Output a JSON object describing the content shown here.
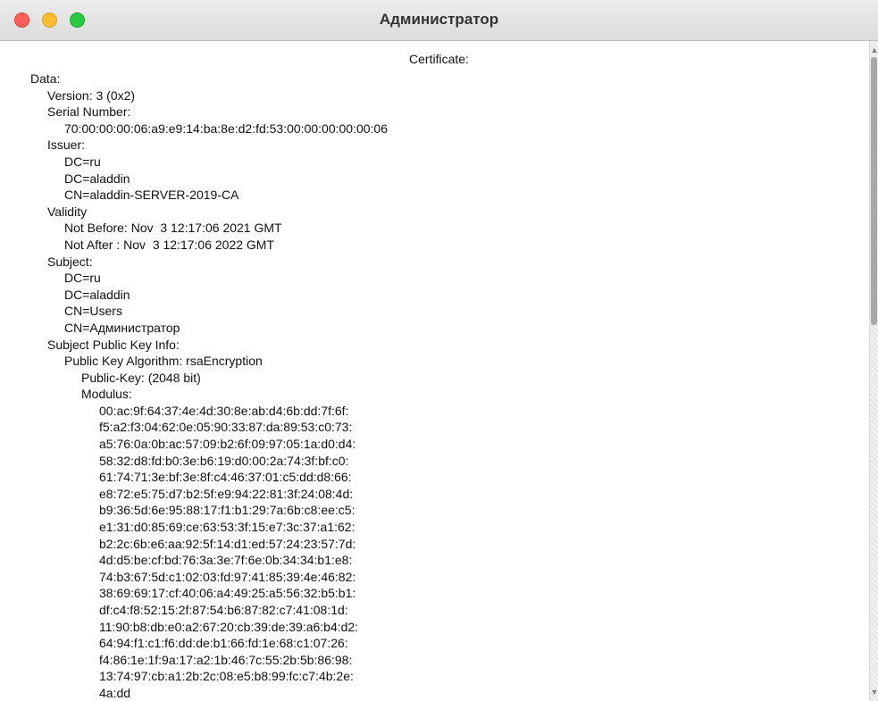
{
  "window": {
    "title": "Администратор",
    "controls": [
      "close-icon",
      "minimize-icon",
      "maximize-icon"
    ],
    "colors": {
      "close": "#ff5f57",
      "minimize": "#febc2e",
      "maximize": "#28c840"
    }
  },
  "certificate": {
    "header": "Certificate:",
    "lines": [
      {
        "indent": 0,
        "text": "Data:"
      },
      {
        "indent": 1,
        "text": "Version: 3 (0x2)"
      },
      {
        "indent": 1,
        "text": "Serial Number:"
      },
      {
        "indent": 2,
        "text": "70:00:00:00:06:a9:e9:14:ba:8e:d2:fd:53:00:00:00:00:00:06"
      },
      {
        "indent": 1,
        "text": "Issuer:"
      },
      {
        "indent": 2,
        "text": "DC=ru"
      },
      {
        "indent": 2,
        "text": "DC=aladdin"
      },
      {
        "indent": 2,
        "text": "CN=aladdin-SERVER-2019-CA"
      },
      {
        "indent": 1,
        "text": "Validity"
      },
      {
        "indent": 2,
        "text": "Not Before: Nov  3 12:17:06 2021 GMT"
      },
      {
        "indent": 2,
        "text": "Not After : Nov  3 12:17:06 2022 GMT"
      },
      {
        "indent": 1,
        "text": "Subject:"
      },
      {
        "indent": 2,
        "text": "DC=ru"
      },
      {
        "indent": 2,
        "text": "DC=aladdin"
      },
      {
        "indent": 2,
        "text": "CN=Users"
      },
      {
        "indent": 2,
        "text": "CN=Администратор"
      },
      {
        "indent": 1,
        "text": "Subject Public Key Info:"
      },
      {
        "indent": 2,
        "text": "Public Key Algorithm: rsaEncryption"
      },
      {
        "indent": 3,
        "text": "Public-Key: (2048 bit)"
      },
      {
        "indent": 3,
        "text": "Modulus:"
      },
      {
        "indent": 4,
        "text": "00:ac:9f:64:37:4e:4d:30:8e:ab:d4:6b:dd:7f:6f:"
      },
      {
        "indent": 4,
        "text": "f5:a2:f3:04:62:0e:05:90:33:87:da:89:53:c0:73:"
      },
      {
        "indent": 4,
        "text": "a5:76:0a:0b:ac:57:09:b2:6f:09:97:05:1a:d0:d4:"
      },
      {
        "indent": 4,
        "text": "58:32:d8:fd:b0:3e:b6:19:d0:00:2a:74:3f:bf:c0:"
      },
      {
        "indent": 4,
        "text": "61:74:71:3e:bf:3e:8f:c4:46:37:01:c5:dd:d8:66:"
      },
      {
        "indent": 4,
        "text": "e8:72:e5:75:d7:b2:5f:e9:94:22:81:3f:24:08:4d:"
      },
      {
        "indent": 4,
        "text": "b9:36:5d:6e:95:88:17:f1:b1:29:7a:6b:c8:ee:c5:"
      },
      {
        "indent": 4,
        "text": "e1:31:d0:85:69:ce:63:53:3f:15:e7:3c:37:a1:62:"
      },
      {
        "indent": 4,
        "text": "b2:2c:6b:e6:aa:92:5f:14:d1:ed:57:24:23:57:7d:"
      },
      {
        "indent": 4,
        "text": "4d:d5:be:cf:bd:76:3a:3e:7f:6e:0b:34:34:b1:e8:"
      },
      {
        "indent": 4,
        "text": "74:b3:67:5d:c1:02:03:fd:97:41:85:39:4e:46:82:"
      },
      {
        "indent": 4,
        "text": "38:69:69:17:cf:40:06:a4:49:25:a5:56:32:b5:b1:"
      },
      {
        "indent": 4,
        "text": "df:c4:f8:52:15:2f:87:54:b6:87:82:c7:41:08:1d:"
      },
      {
        "indent": 4,
        "text": "11:90:b8:db:e0:a2:67:20:cb:39:de:39:a6:b4:d2:"
      },
      {
        "indent": 4,
        "text": "64:94:f1:c1:f6:dd:de:b1:66:fd:1e:68:c1:07:26:"
      },
      {
        "indent": 4,
        "text": "f4:86:1e:1f:9a:17:a2:1b:46:7c:55:2b:5b:86:98:"
      },
      {
        "indent": 4,
        "text": "13:74:97:cb:a1:2b:2c:08:e5:b8:99:fc:c7:4b:2e:"
      },
      {
        "indent": 4,
        "text": "4a:dd"
      }
    ]
  },
  "scrollbar": {
    "icons": [
      "chevron-up-icon",
      "chevron-down-icon"
    ],
    "up_glyph": "▲",
    "down_glyph": "▼"
  }
}
